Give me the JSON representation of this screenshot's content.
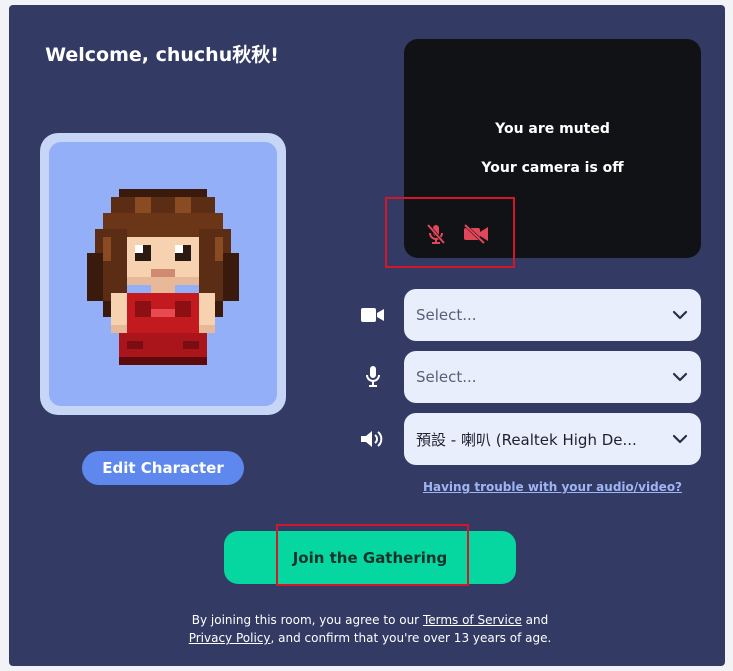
{
  "welcome": {
    "title": "Welcome, chuchu秋秋!"
  },
  "avatar": {
    "edit_label": "Edit Character"
  },
  "video_preview": {
    "muted_text": "You are muted",
    "camera_text": "Your camera is off",
    "icons": [
      "mic-off-icon",
      "camera-off-icon"
    ]
  },
  "devices": {
    "camera": {
      "icon": "camera-icon",
      "value": "Select..."
    },
    "microphone": {
      "icon": "microphone-icon",
      "value": "Select..."
    },
    "speaker": {
      "icon": "speaker-icon",
      "value": "預設 - 喇叭 (Realtek High De..."
    }
  },
  "trouble_link": "Having trouble with your audio/video?",
  "join_label": "Join the Gathering",
  "legal": {
    "part1": "By joining this room, you agree to our ",
    "terms": "Terms of Service",
    "part2": " and",
    "privacy": "Privacy Policy",
    "part3": ", and confirm that you're over 13 years of age."
  },
  "colors": {
    "panel_bg": "#333a64",
    "join_button": "#06d6a0",
    "edit_button": "#5e88ee",
    "status_icon_red": "#e0475a",
    "highlight_red": "#d1172b"
  }
}
